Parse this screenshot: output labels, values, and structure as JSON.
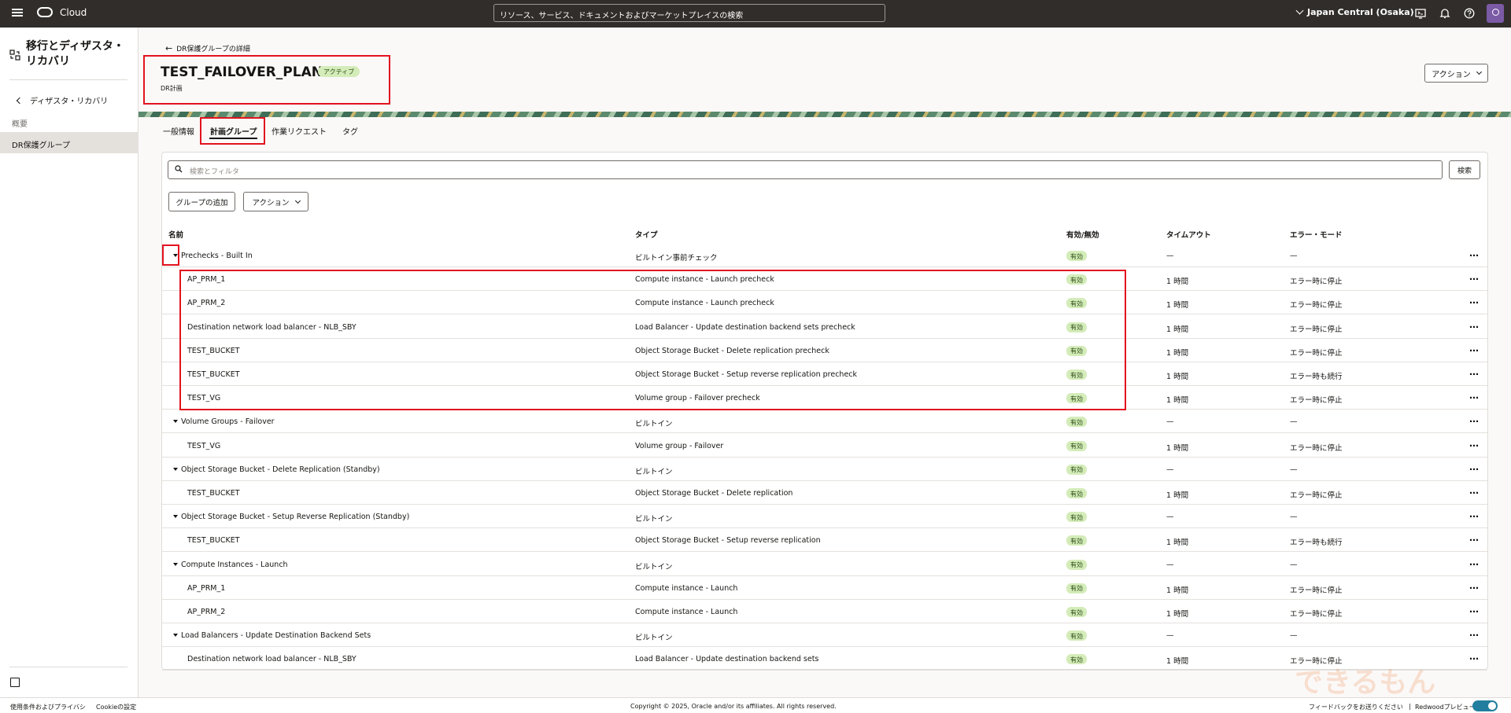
{
  "topbar": {
    "brand": "Cloud",
    "search_placeholder": "リソース、サービス、ドキュメントおよびマーケットプレイスの検索",
    "region": "Japan Central (Osaka)"
  },
  "sidebar": {
    "title": "移行とディザスタ・リカバリ",
    "back_label": "ディザスタ・リカバリ",
    "overview_label": "概要",
    "active_label": "DR保護グループ"
  },
  "header": {
    "back_link": "DR保護グループの詳細",
    "title": "TEST_FAILOVER_PLAN",
    "status": "アクティブ",
    "subtitle": "DR計画",
    "actions_label": "アクション"
  },
  "tabs": [
    {
      "label": "一般情報"
    },
    {
      "label": "計画グループ"
    },
    {
      "label": "作業リクエスト"
    },
    {
      "label": "タグ"
    }
  ],
  "toolbar": {
    "search_placeholder": "検索とフィルタ",
    "search_button": "検索",
    "add_group_button": "グループの追加",
    "actions_button": "アクション"
  },
  "table": {
    "columns": [
      "名前",
      "タイプ",
      "有効/無効",
      "タイムアウト",
      "エラー・モード"
    ],
    "rows": [
      {
        "group": true,
        "name": "Prechecks - Built In",
        "type": "ビルトイン事前チェック",
        "enabled": "有効",
        "timeout": "—",
        "error_mode": "—"
      },
      {
        "group": false,
        "name": "AP_PRM_1",
        "type": "Compute instance - Launch precheck",
        "enabled": "有効",
        "timeout": "1 時間",
        "error_mode": "エラー時に停止"
      },
      {
        "group": false,
        "name": "AP_PRM_2",
        "type": "Compute instance - Launch precheck",
        "enabled": "有効",
        "timeout": "1 時間",
        "error_mode": "エラー時に停止"
      },
      {
        "group": false,
        "name": "Destination network load balancer - NLB_SBY",
        "type": "Load Balancer - Update destination backend sets precheck",
        "enabled": "有効",
        "timeout": "1 時間",
        "error_mode": "エラー時に停止"
      },
      {
        "group": false,
        "name": "TEST_BUCKET",
        "type": "Object Storage Bucket - Delete replication precheck",
        "enabled": "有効",
        "timeout": "1 時間",
        "error_mode": "エラー時に停止"
      },
      {
        "group": false,
        "name": "TEST_BUCKET",
        "type": "Object Storage Bucket - Setup reverse replication precheck",
        "enabled": "有効",
        "timeout": "1 時間",
        "error_mode": "エラー時も続行"
      },
      {
        "group": false,
        "name": "TEST_VG",
        "type": "Volume group - Failover precheck",
        "enabled": "有効",
        "timeout": "1 時間",
        "error_mode": "エラー時に停止"
      },
      {
        "group": true,
        "name": "Volume Groups - Failover",
        "type": "ビルトイン",
        "enabled": "有効",
        "timeout": "—",
        "error_mode": "—"
      },
      {
        "group": false,
        "name": "TEST_VG",
        "type": "Volume group - Failover",
        "enabled": "有効",
        "timeout": "1 時間",
        "error_mode": "エラー時に停止"
      },
      {
        "group": true,
        "name": "Object Storage Bucket - Delete Replication (Standby)",
        "type": "ビルトイン",
        "enabled": "有効",
        "timeout": "—",
        "error_mode": "—"
      },
      {
        "group": false,
        "name": "TEST_BUCKET",
        "type": "Object Storage Bucket - Delete replication",
        "enabled": "有効",
        "timeout": "1 時間",
        "error_mode": "エラー時に停止"
      },
      {
        "group": true,
        "name": "Object Storage Bucket - Setup Reverse Replication (Standby)",
        "type": "ビルトイン",
        "enabled": "有効",
        "timeout": "—",
        "error_mode": "—"
      },
      {
        "group": false,
        "name": "TEST_BUCKET",
        "type": "Object Storage Bucket - Setup reverse replication",
        "enabled": "有効",
        "timeout": "1 時間",
        "error_mode": "エラー時も続行"
      },
      {
        "group": true,
        "name": "Compute Instances - Launch",
        "type": "ビルトイン",
        "enabled": "有効",
        "timeout": "—",
        "error_mode": "—"
      },
      {
        "group": false,
        "name": "AP_PRM_1",
        "type": "Compute instance - Launch",
        "enabled": "有効",
        "timeout": "1 時間",
        "error_mode": "エラー時に停止"
      },
      {
        "group": false,
        "name": "AP_PRM_2",
        "type": "Compute instance - Launch",
        "enabled": "有効",
        "timeout": "1 時間",
        "error_mode": "エラー時に停止"
      },
      {
        "group": true,
        "name": "Load Balancers - Update Destination Backend Sets",
        "type": "ビルトイン",
        "enabled": "有効",
        "timeout": "—",
        "error_mode": "—"
      },
      {
        "group": false,
        "name": "Destination network load balancer - NLB_SBY",
        "type": "Load Balancer - Update destination backend sets",
        "enabled": "有効",
        "timeout": "1 時間",
        "error_mode": "エラー時に停止"
      }
    ]
  },
  "footer": {
    "terms": "使用条件およびプライバシ",
    "cookies": "Cookieの設定",
    "copyright": "Copyright © 2025, Oracle and/or its affiliates. All rights reserved.",
    "feedback": "フィードバックをお送りください",
    "separator": "|",
    "redwood": "Redwoodプレビュー"
  },
  "colors": {
    "topbar": "#312d2a",
    "highlight": "#e2131f",
    "pill_bg": "#d4ecb9",
    "toggle": "#227e9e"
  }
}
